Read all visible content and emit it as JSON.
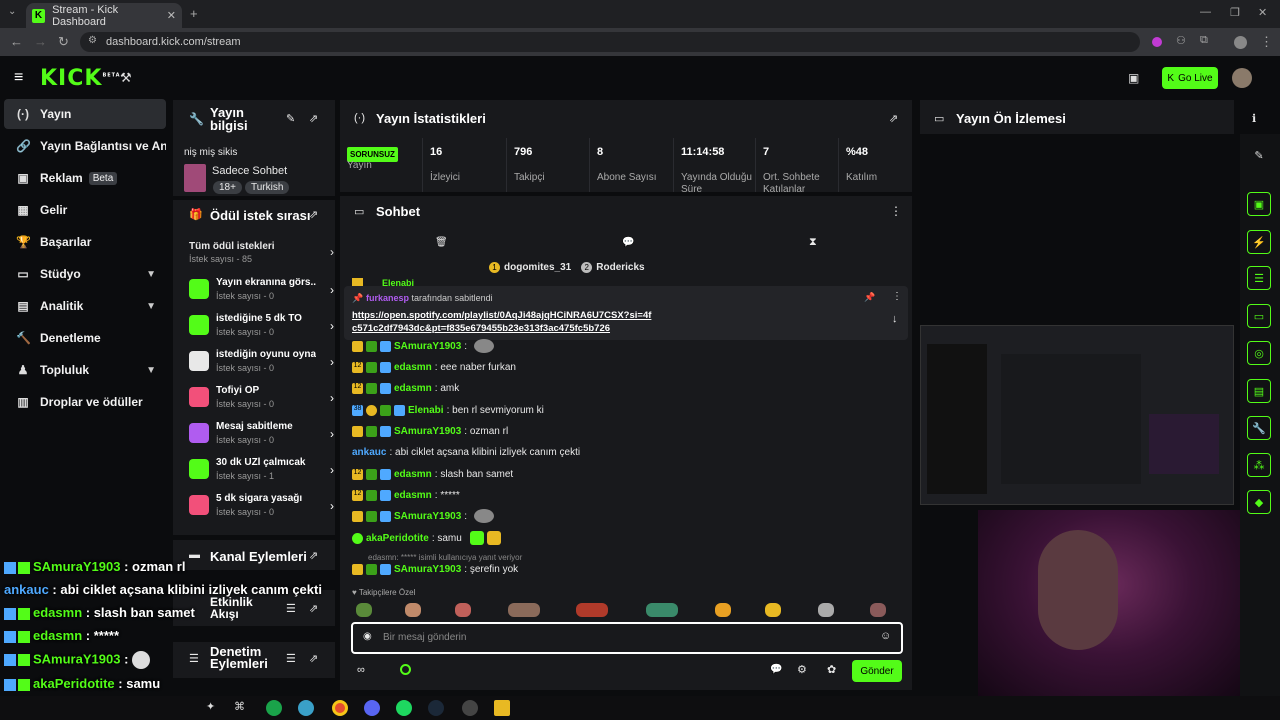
{
  "browser": {
    "tab_title": "Stream - Kick Dashboard",
    "tab_close": "✕",
    "new_tab": "+",
    "url": "dashboard.kick.com/stream"
  },
  "header": {
    "logo": "KICK",
    "logo_badge": "BETA",
    "go_live": "Go Live"
  },
  "sidebar": {
    "items": [
      {
        "label": "Yayın",
        "icon": "(·)"
      },
      {
        "label": "Yayın Bağlantısı ve Anahtar",
        "icon": "🔗"
      },
      {
        "label": "Reklam",
        "icon": "▣",
        "badge": "Beta"
      },
      {
        "label": "Gelir",
        "icon": "▦"
      },
      {
        "label": "Başarılar",
        "icon": "🏆"
      },
      {
        "label": "Stüdyo",
        "icon": "▭"
      },
      {
        "label": "Analitik",
        "icon": "▤"
      },
      {
        "label": "Denetleme",
        "icon": "🔨"
      },
      {
        "label": "Topluluk",
        "icon": "♟"
      },
      {
        "label": "Droplar ve ödüller",
        "icon": "▥"
      }
    ]
  },
  "stream_info": {
    "title": "Yayın bilgisi",
    "stream_title": "niş miş sikis",
    "category": "Sadece Sohbet",
    "tags": [
      "18+",
      "Turkish"
    ]
  },
  "rewards": {
    "title": "Ödül istek sırası",
    "all_label": "Tüm ödül istekleri",
    "all_count": "İstek sayısı - 85",
    "items": [
      {
        "title": "Yayın ekranına görs...",
        "count": "İstek sayısı - 0",
        "color": "#53fc18"
      },
      {
        "title": "istediğine 5 dk TO",
        "count": "İstek sayısı - 0",
        "color": "#53fc18"
      },
      {
        "title": "istediğin oyunu oyna...",
        "count": "İstek sayısı - 0",
        "color": "#e8e8e8"
      },
      {
        "title": "Tofiyi ÖP",
        "count": "İstek sayısı - 0",
        "color": "#f2507a"
      },
      {
        "title": "Mesaj sabitleme",
        "count": "İstek sayısı - 0",
        "color": "#b05cf0"
      },
      {
        "title": "30 dk UZİ çalmıcak",
        "count": "İstek sayısı - 1",
        "color": "#53fc18"
      },
      {
        "title": "5 dk sigara yasağı",
        "count": "İstek sayısı - 0",
        "color": "#f2507a"
      }
    ]
  },
  "channel_actions": {
    "title": "Kanal Eylemleri"
  },
  "activity": {
    "title": "Etkinlik Akışı"
  },
  "mod_actions": {
    "title": "Denetim Eylemleri"
  },
  "stats": {
    "title": "Yayın İstatistikleri",
    "status_badge": "SORUNSUZ",
    "items": [
      {
        "value": "",
        "label": "Yayın"
      },
      {
        "value": "16",
        "label": "İzleyici"
      },
      {
        "value": "796",
        "label": "Takipçi"
      },
      {
        "value": "8",
        "label": "Abone Sayısı"
      },
      {
        "value": "11:14:58",
        "label": "Yayında Olduğu Süre"
      },
      {
        "value": "7",
        "label": "Ort. Sohbete Katılanlar"
      },
      {
        "value": "%48",
        "label": "Katılım"
      }
    ]
  },
  "chat": {
    "title": "Sohbet",
    "top_gifters": [
      "dogomites_31",
      "Rodericks"
    ],
    "top_ranks": [
      "1",
      "2"
    ],
    "partial_name": "Elenabi",
    "pinned_by_user": "furkanesp",
    "pinned_by_suffix": "tarafından sabitlendi",
    "pinned_link": "https://open.spotify.com/playlist/0AqJi48ajqHCiNRA6U7CSX?si=4fc571c2df7943dc&pt=f835e679455b23e313f3ac475fc5b726",
    "messages": [
      {
        "user": "SAmuraY1903",
        "text": "",
        "color": "#53fc18",
        "badge": "crown"
      },
      {
        "user": "edasmn",
        "text": "eee naber furkan",
        "color": "#53fc18",
        "badge": "12"
      },
      {
        "user": "edasmn",
        "text": "amk",
        "color": "#53fc18",
        "badge": "12"
      },
      {
        "user": "Elenabi",
        "text": "ben rl sevmiyorum ki",
        "color": "#53fc18",
        "badge": "38"
      },
      {
        "user": "SAmuraY1903",
        "text": "ozman rl",
        "color": "#53fc18",
        "badge": "crown"
      },
      {
        "user": "ankauc",
        "text": "abi ciklet açsana klibini izliyek canım çekti",
        "color": "#4fa9ff",
        "badge": ""
      },
      {
        "user": "edasmn",
        "text": "slash ban samet",
        "color": "#53fc18",
        "badge": "12"
      },
      {
        "user": "edasmn",
        "text": "*****",
        "color": "#53fc18",
        "badge": "12"
      },
      {
        "user": "SAmuraY1903",
        "text": "",
        "color": "#53fc18",
        "badge": "crown"
      },
      {
        "user": "akaPeridotite",
        "text": "samu",
        "color": "#53fc18",
        "badge": "emoji"
      },
      {
        "user": "SAmuraY1903",
        "text": "şerefin yok",
        "color": "#53fc18",
        "badge": "crown"
      }
    ],
    "reply_note": "edasmn: ***** isimli kullanıcıya yanıt veriyor",
    "emote_section": "Takipçilere Özel",
    "input_placeholder": "Bir mesaj gönderin",
    "send_label": "Gönder"
  },
  "preview": {
    "title": "Yayın Ön İzlemesi"
  },
  "overlay_chat": [
    {
      "user": "SAmuraY1903",
      "text": "ozman rl",
      "color": "#53fc18"
    },
    {
      "user": "ankauc",
      "text": "abi ciklet açsana klibini izliyek canım çekti",
      "color": "#4fa9ff"
    },
    {
      "user": "edasmn",
      "text": "slash ban samet",
      "color": "#53fc18"
    },
    {
      "user": "edasmn",
      "text": "*****",
      "color": "#53fc18"
    },
    {
      "user": "SAmuraY1903",
      "text": "",
      "color": "#53fc18"
    },
    {
      "user": "akaPeridotite",
      "text": "samu",
      "color": "#53fc18"
    },
    {
      "user": "SAmuraY1903",
      "text": "şerefin yok",
      "color": "#53fc18"
    }
  ],
  "colors": {
    "accent": "#53fc18",
    "panel": "#18191c",
    "bg": "#0b0c0e"
  }
}
